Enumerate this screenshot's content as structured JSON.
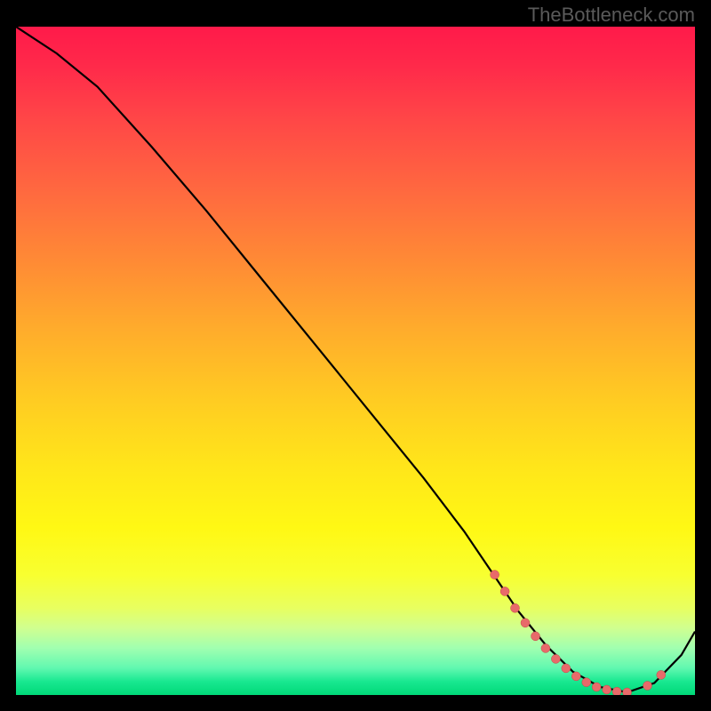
{
  "watermark": "TheBottleneck.com",
  "chart_data": {
    "type": "line",
    "title": "",
    "xlabel": "",
    "ylabel": "",
    "xlim": [
      0,
      100
    ],
    "ylim": [
      0,
      100
    ],
    "curve": {
      "x": [
        0,
        6,
        12,
        20,
        28,
        36,
        44,
        52,
        60,
        66,
        70,
        74,
        78,
        82,
        86,
        90,
        94,
        98,
        100
      ],
      "y": [
        100,
        96,
        91,
        82,
        72.5,
        62.5,
        52.5,
        42.5,
        32.5,
        24.5,
        18.5,
        12.5,
        7.5,
        3.5,
        1.2,
        0.4,
        1.8,
        6.0,
        9.5
      ]
    },
    "points": {
      "x": [
        70.5,
        72.0,
        73.5,
        75.0,
        76.5,
        78.0,
        79.5,
        81.0,
        82.5,
        84.0,
        85.5,
        87.0,
        88.5,
        90.0,
        93.0,
        95.0
      ],
      "y": [
        18.0,
        15.5,
        13.0,
        10.8,
        8.8,
        7.0,
        5.4,
        4.0,
        2.8,
        1.9,
        1.2,
        0.8,
        0.5,
        0.4,
        1.4,
        3.0
      ]
    },
    "gradient_stops": [
      {
        "pos": 0,
        "color": "#ff1a4a"
      },
      {
        "pos": 50,
        "color": "#ffcc22"
      },
      {
        "pos": 85,
        "color": "#f8ff30"
      },
      {
        "pos": 100,
        "color": "#00d878"
      }
    ]
  }
}
